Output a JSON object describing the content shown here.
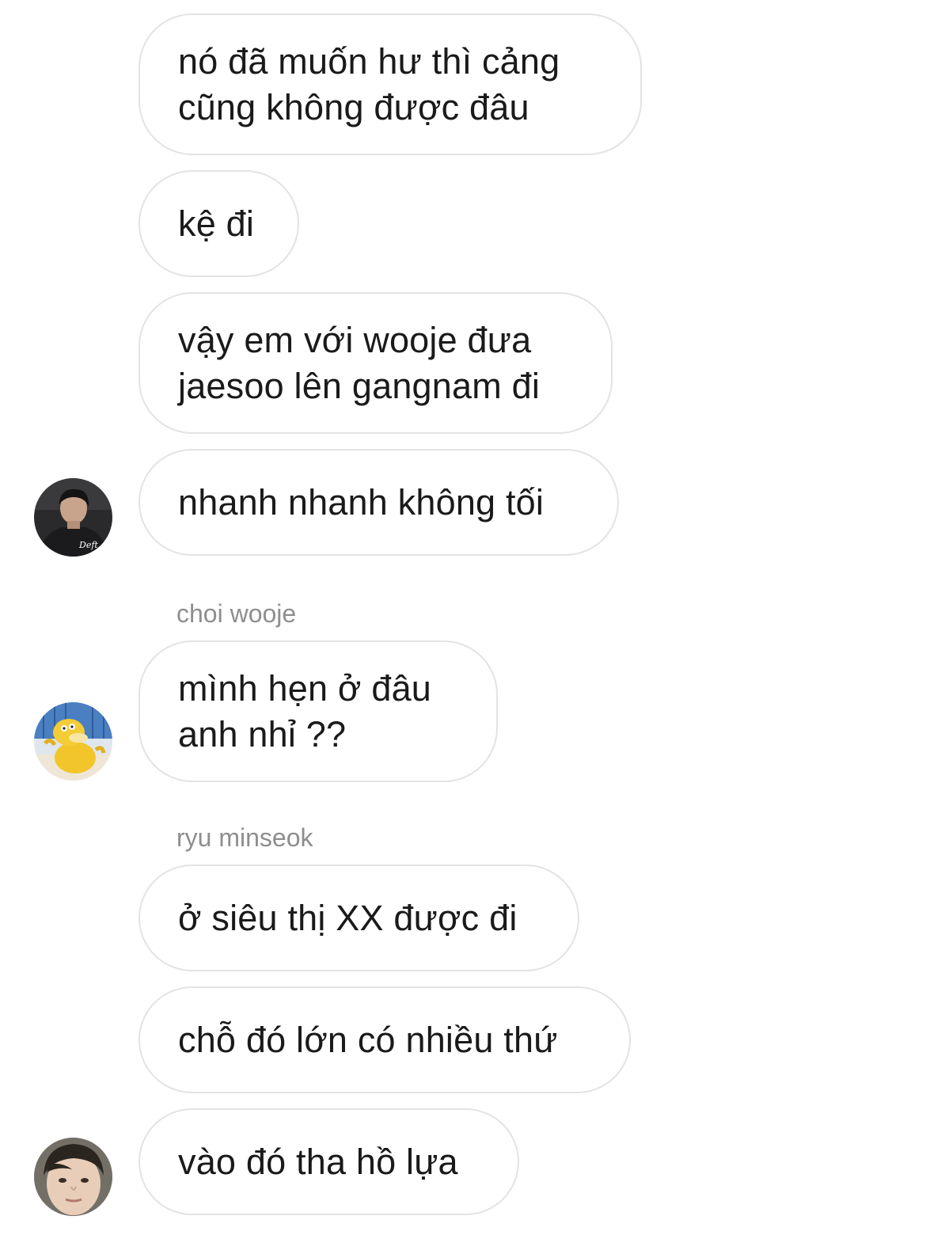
{
  "messages": [
    {
      "text": "nó đã muốn hư thì cảng\ncũng không được đâu"
    },
    {
      "text": "kệ đi"
    },
    {
      "text": "vậy em với wooje đưa\njaesoo lên gangnam đi"
    },
    {
      "text": "nhanh nhanh không tối"
    },
    {
      "text": "mình hẹn ở đâu\nanh nhỉ ??"
    },
    {
      "text": "ở siêu thị XX được đi"
    },
    {
      "text": "chỗ đó lớn có nhiều thứ"
    },
    {
      "text": "vào đó tha hồ lựa"
    }
  ],
  "senders": [
    {
      "name": "choi wooje"
    },
    {
      "name": "ryu minseok"
    }
  ],
  "avatars": [
    {
      "icon": "avatar-dark-jacket-photo",
      "caption": "Deft"
    },
    {
      "icon": "avatar-yellow-duck-cartoon"
    },
    {
      "icon": "avatar-face-photo"
    }
  ]
}
